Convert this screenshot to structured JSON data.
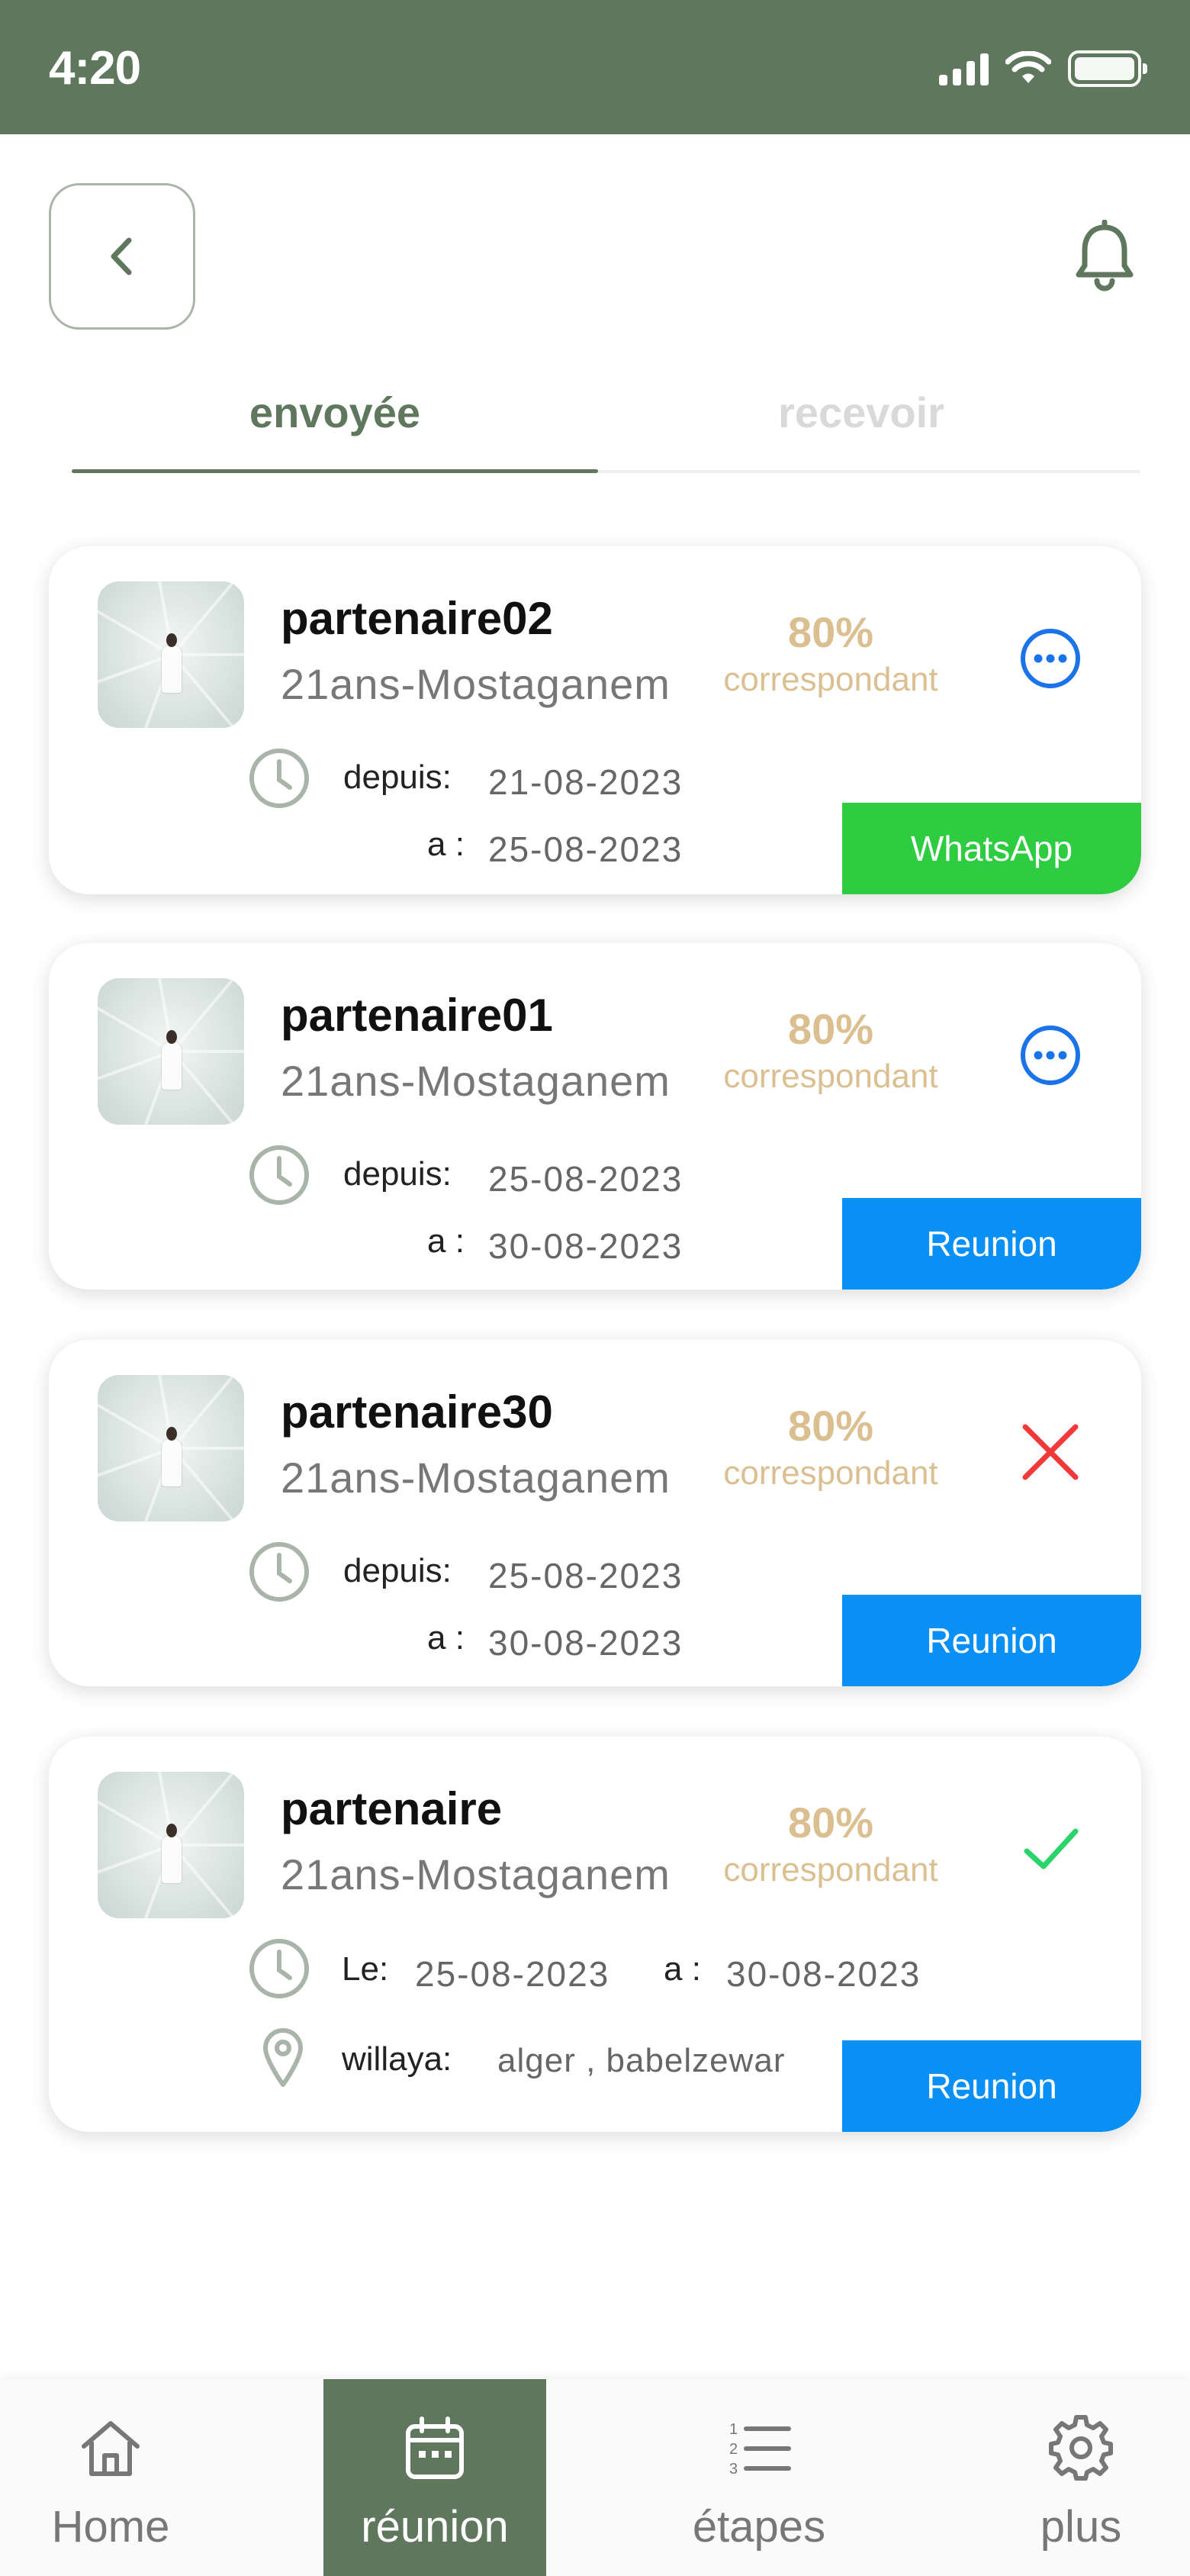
{
  "status_bar": {
    "time": "4:20"
  },
  "tabs": [
    {
      "label": "envoyée",
      "active": true
    },
    {
      "label": "recevoir",
      "active": false
    }
  ],
  "colors": {
    "primary": "#5f775d",
    "match": "#dbbf90",
    "whatsapp": "#2ecc40",
    "reunion": "#0a8ff5",
    "more_icon": "#1a73e8",
    "reject_icon": "#f03a3a",
    "accept_icon": "#2ad46a"
  },
  "cards": [
    {
      "name": "partenaire02",
      "subtitle": "21ans-Mostaganem",
      "match_percent": "80%",
      "match_label": "correspondant",
      "status_icon": "more-icon",
      "from_label": "depuis:",
      "from_date": "21-08-2023",
      "to_label": "a :",
      "to_date": "25-08-2023",
      "action_label": "WhatsApp"
    },
    {
      "name": "partenaire01",
      "subtitle": "21ans-Mostaganem",
      "match_percent": "80%",
      "match_label": "correspondant",
      "status_icon": "more-icon",
      "from_label": "depuis:",
      "from_date": "25-08-2023",
      "to_label": "a :",
      "to_date": "30-08-2023",
      "action_label": "Reunion"
    },
    {
      "name": "partenaire30",
      "subtitle": "21ans-Mostaganem",
      "match_percent": "80%",
      "match_label": "correspondant",
      "status_icon": "close-icon",
      "from_label": "depuis:",
      "from_date": "25-08-2023",
      "to_label": "a :",
      "to_date": "30-08-2023",
      "action_label": "Reunion"
    },
    {
      "name": "partenaire",
      "subtitle": "21ans-Mostaganem",
      "match_percent": "80%",
      "match_label": "correspondant",
      "status_icon": "check-icon",
      "date_label": "Le:",
      "date": "25-08-2023",
      "to_label": "a :",
      "to_date": "30-08-2023",
      "location_label": "willaya:",
      "location": "alger , babelzewar",
      "action_label": "Reunion"
    }
  ],
  "bottom_nav": [
    {
      "label": "Home",
      "icon": "home-icon",
      "active": false
    },
    {
      "label": "réunion",
      "icon": "calendar-icon",
      "active": true
    },
    {
      "label": "étapes",
      "icon": "steps-list-icon",
      "active": false
    },
    {
      "label": "plus",
      "icon": "gear-icon",
      "active": false
    }
  ]
}
